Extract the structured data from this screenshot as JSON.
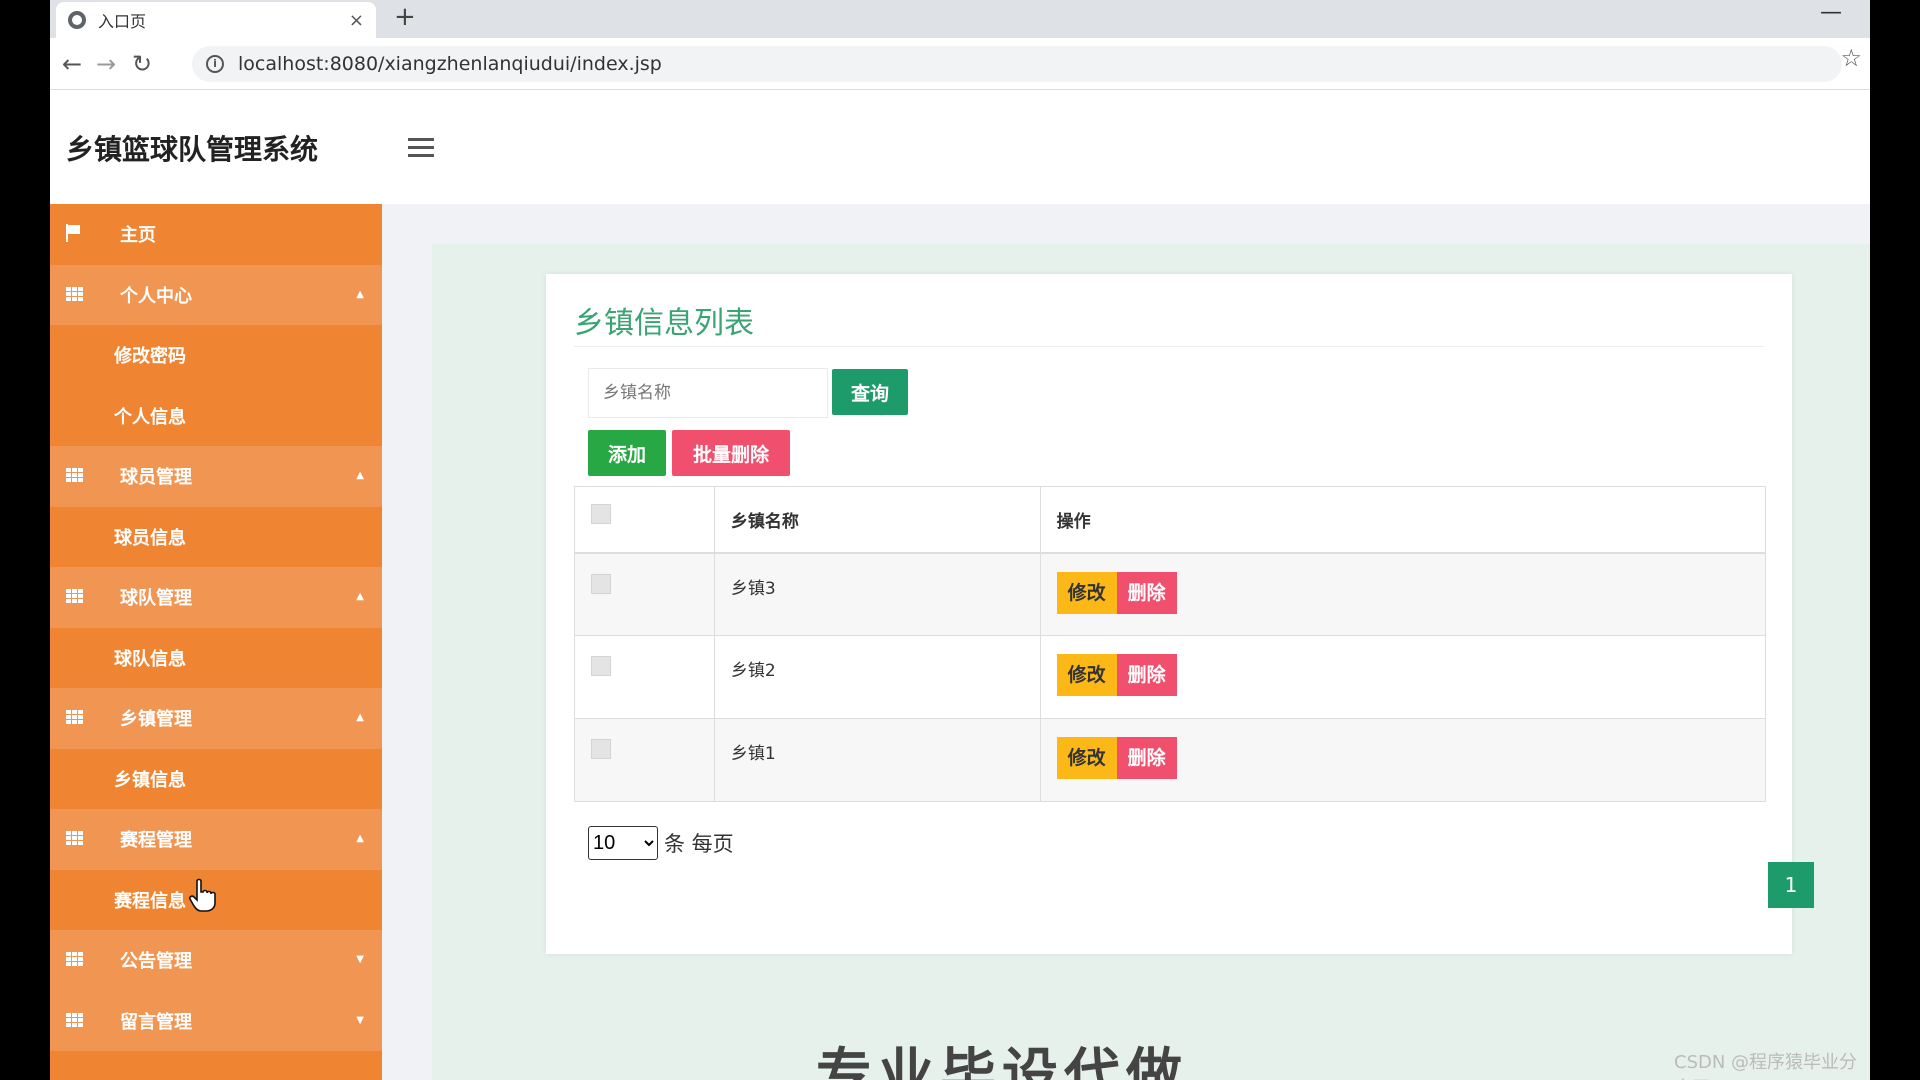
{
  "browser": {
    "tab_title": "入口页",
    "tab_close": "×",
    "new_tab": "+",
    "minimize": "—",
    "back": "←",
    "forward": "→",
    "reload": "↻",
    "url": "localhost:8080/xiangzhenlanqiudui/index.jsp",
    "info": "i",
    "star": "☆"
  },
  "app": {
    "title": "乡镇篮球队管理系统"
  },
  "sidebar": {
    "items": [
      {
        "label": "主页",
        "type": "top"
      },
      {
        "label": "个人中心",
        "type": "parent",
        "caret": "▲"
      },
      {
        "label": "修改密码",
        "type": "child"
      },
      {
        "label": "个人信息",
        "type": "child"
      },
      {
        "label": "球员管理",
        "type": "parent",
        "caret": "▲"
      },
      {
        "label": "球员信息",
        "type": "child"
      },
      {
        "label": "球队管理",
        "type": "parent",
        "caret": "▲"
      },
      {
        "label": "球队信息",
        "type": "child"
      },
      {
        "label": "乡镇管理",
        "type": "parent",
        "caret": "▲"
      },
      {
        "label": "乡镇信息",
        "type": "child"
      },
      {
        "label": "赛程管理",
        "type": "parent",
        "caret": "▲"
      },
      {
        "label": "赛程信息",
        "type": "child"
      },
      {
        "label": "公告管理",
        "type": "parent",
        "caret": "▼"
      },
      {
        "label": "留言管理",
        "type": "parent",
        "caret": "▼"
      }
    ]
  },
  "main": {
    "card_title": "乡镇信息列表",
    "search_placeholder": "乡镇名称",
    "query_label": "查询",
    "add_label": "添加",
    "batch_delete_label": "批量删除",
    "table": {
      "headers": [
        "",
        "乡镇名称",
        "操作"
      ],
      "rows": [
        {
          "name": "乡镇3"
        },
        {
          "name": "乡镇2"
        },
        {
          "name": "乡镇1"
        }
      ],
      "edit_label": "修改",
      "delete_label": "删除"
    },
    "page_size": "10",
    "page_size_unit": "条 每页",
    "current_page": "1"
  },
  "overlay": {
    "bottom_text": "专业毕设代做",
    "watermark": "CSDN @程序猿毕业分享网"
  },
  "colors": {
    "sidebar_bg": "#ef8532",
    "sidebar_parent_bg": "#f09652",
    "accent_green": "#1e9b6a",
    "add_green": "#28a745",
    "danger_red": "#f0506e",
    "warning_yellow": "#fcb817",
    "title_green": "#3aa572"
  }
}
